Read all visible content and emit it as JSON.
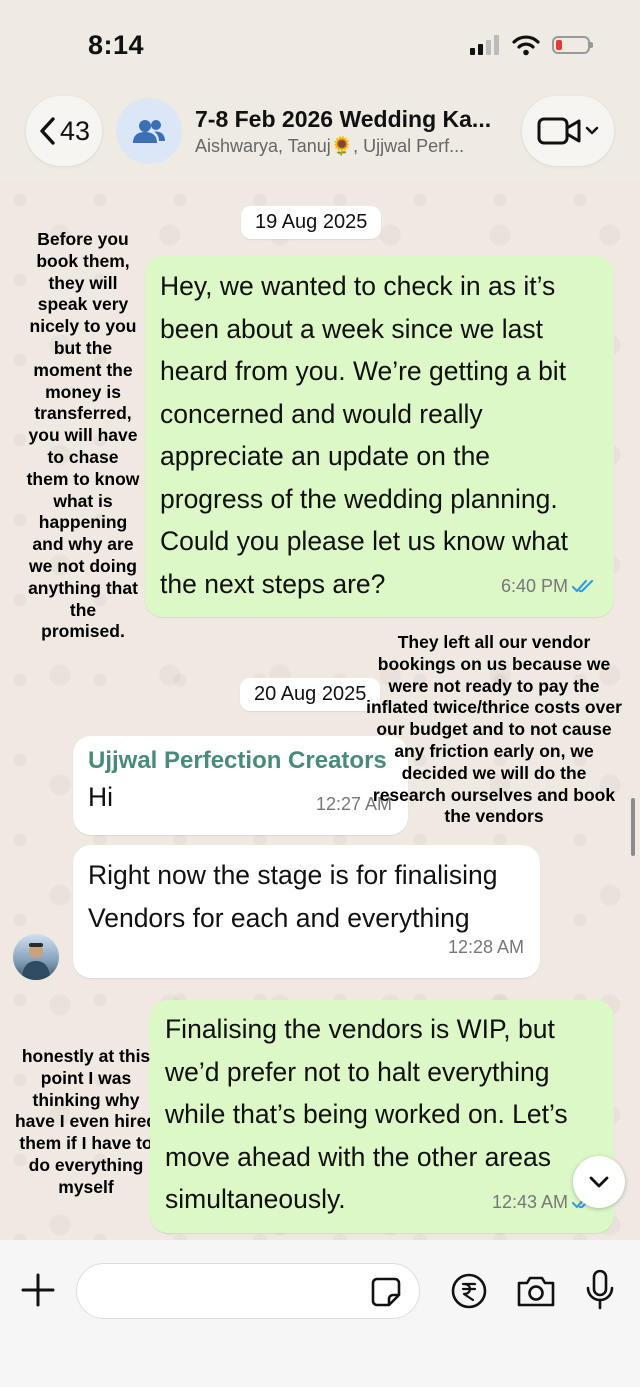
{
  "status_bar": {
    "time": "8:14"
  },
  "header": {
    "back_count": "43",
    "title": "7-8 Feb 2026 Wedding Ka...",
    "subtitle": "Aishwarya, Tanuj🌻, Ujjwal Perf..."
  },
  "dates": [
    "19 Aug 2025",
    "20 Aug 2025"
  ],
  "messages": [
    {
      "direction": "out",
      "text": "Hey, we wanted to check in as it’s been about a week since we last heard from you. We’re getting a bit concerned and would really appreciate an update on the progress of the wedding planning. Could you please let us know what the next steps are?",
      "time": "6:40 PM"
    },
    {
      "direction": "in",
      "sender": "Ujjwal Perfection Creators",
      "text": "Hi",
      "time": "12:27 AM"
    },
    {
      "direction": "in",
      "text": "Right now the stage is for finalising Vendors for each and everything",
      "time": "12:28 AM"
    },
    {
      "direction": "out",
      "text": "Finalising the vendors is WIP, but we’d prefer not to halt everything while that’s being worked on. Let’s move ahead with the other areas simultaneously.",
      "time": "12:43 AM"
    }
  ],
  "annotations": [
    "Before you book them, they will speak very nicely to you but the moment the money is transferred, you will have to chase them to know what is happening and why are we not doing anything that the promised.",
    "They left all our vendor bookings on us because we were not ready to pay the inflated twice/thrice costs over our budget and to not cause any friction early on, we decided we will do the research ourselves and book the vendors",
    "honestly at this point I was thinking why have I even hired them if I have to do everything myself"
  ],
  "input": {
    "placeholder": ""
  },
  "colors": {
    "outgoing_bubble": "#dbf8c6",
    "incoming_bubble": "#ffffff",
    "read_ticks": "#3b9be0",
    "sender_name": "#4a8a7a"
  },
  "icons": [
    "back-chevron-icon",
    "group-icon",
    "video-call-icon",
    "plus-icon",
    "sticker-icon",
    "rupee-payment-icon",
    "camera-icon",
    "microphone-icon",
    "double-check-icon",
    "chevron-down-icon"
  ]
}
